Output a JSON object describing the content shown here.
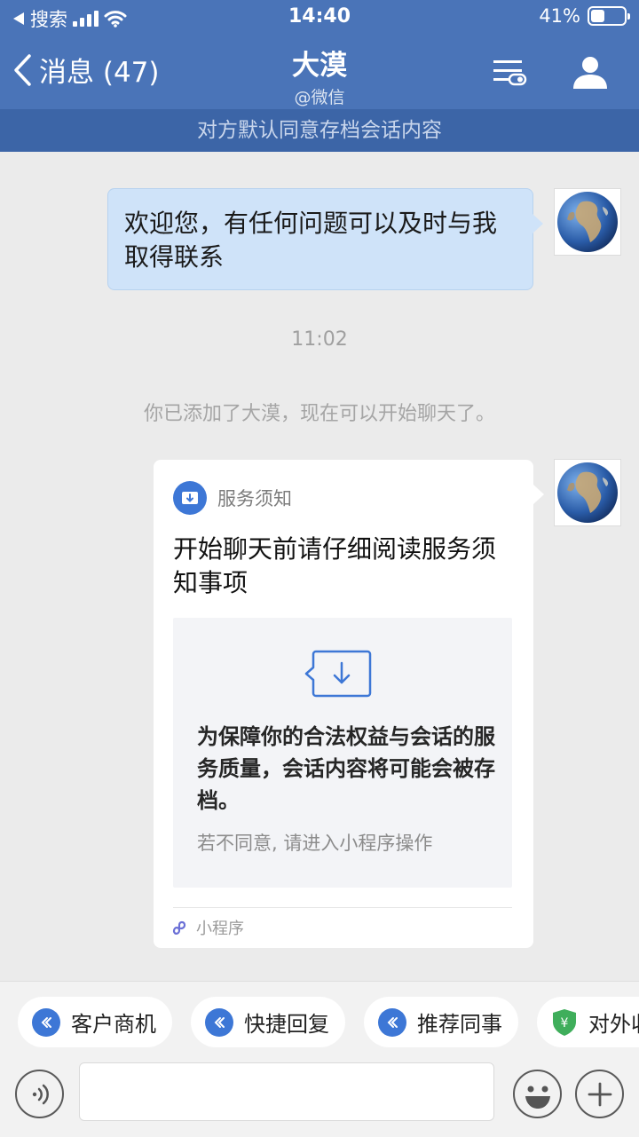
{
  "status_bar": {
    "back_app": "搜索",
    "time": "14:40",
    "battery_text": "41%",
    "battery_level": 0.41
  },
  "header": {
    "back_label": "消息 (47)",
    "title": "大漠",
    "subtitle": "@微信"
  },
  "notice": "对方默认同意存档会话内容",
  "messages": {
    "welcome": "欢迎您，有任何问题可以及时与我取得联系",
    "timestamp": "11:02",
    "system": "你已添加了大漠，现在可以开始聊天了。"
  },
  "card": {
    "header_label": "服务须知",
    "title": "开始聊天前请仔细阅读服务须知事项",
    "body": "为保障你的合法权益与会话的服务质量，会话内容将可能会被存档。",
    "note": "若不同意, 请进入小程序操作",
    "footer": "小程序"
  },
  "quick_actions": [
    "客户商机",
    "快捷回复",
    "推荐同事",
    "对外收款"
  ],
  "input": {
    "value": "",
    "placeholder": ""
  },
  "colors": {
    "header_blue": "#4a74b8",
    "notice_blue": "#3c65a7",
    "bubble": "#cfe3f9",
    "accent": "#3d77d6",
    "payment_green": "#3fae5b"
  }
}
